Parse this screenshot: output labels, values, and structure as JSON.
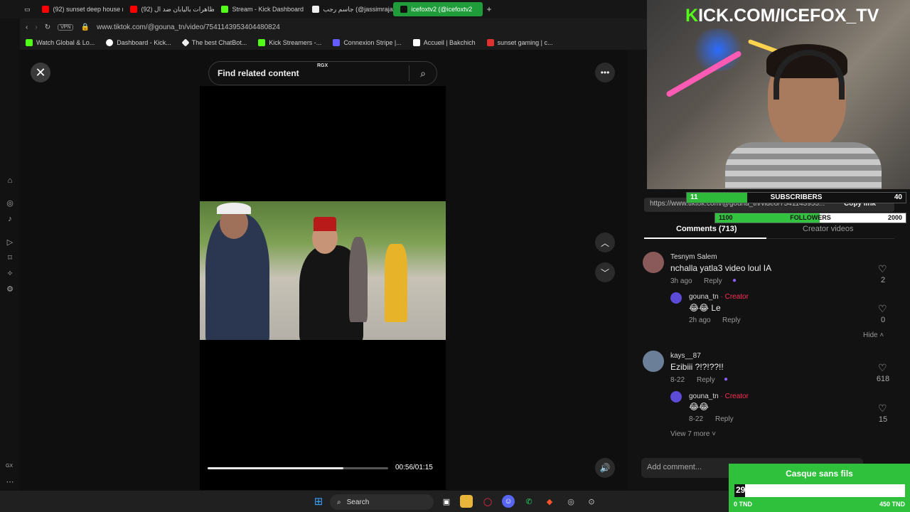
{
  "browser": {
    "tabs": [
      {
        "label": "(92) sunset deep house m",
        "color": "#ff0000",
        "active": false
      },
      {
        "label": "(92) مظاهرات باليابان ضد ال",
        "color": "#ff0000",
        "active": false
      },
      {
        "label": "Stream - Kick Dashboard",
        "color": "#53fc18",
        "active": false
      },
      {
        "label": "جاسم رجب (@jassimrajab)",
        "color": "#ffffff",
        "active": false
      },
      {
        "label": "icefoxtv2 (@icefoxtv2",
        "color": "#ffffff",
        "active": true
      }
    ],
    "vpn_label": "VPN",
    "url": "www.tiktok.com/@gouna_tn/video/7541143953404480824",
    "bookmarks": [
      "Watch Global & Lo...",
      "Dashboard - Kick...",
      "The best ChatBot...",
      "Kick Streamers -...",
      "Connexion Stripe |...",
      "Accueil | Bakchich",
      "sunset gaming | c..."
    ]
  },
  "sidebar": {
    "gx_label": "GX"
  },
  "tiktok": {
    "search_placeholder": "Find related content",
    "rgx_label": "RGX",
    "time": "00:56/01:15",
    "progress_fraction": 0.75,
    "link_text": "https://www.tiktok.com/@gouna_tn/video/7541143953...",
    "copy_link": "Copy link",
    "tab_comments": "Comments (713)",
    "tab_creator": "Creator videos",
    "comments": [
      {
        "name": "Tesnym Salem",
        "text": "nchalla yatla3 video loul IA",
        "time": "3h ago",
        "reply": "Reply",
        "likes": "2"
      },
      {
        "name": "gouna_tn",
        "creator": "· Creator",
        "text": "😂😂 Le",
        "time": "2h ago",
        "reply": "Reply",
        "likes": "0"
      },
      {
        "name": "kays__87",
        "text": "Ezibiii ?!?!??!!",
        "time": "8-22",
        "reply": "Reply",
        "likes": "618"
      },
      {
        "name": "gouna_tn",
        "creator": "· Creator",
        "text": "😂😂",
        "time": "8-22",
        "reply": "Reply",
        "likes": "15"
      }
    ],
    "hide_label": "Hide",
    "view_more": "View 7 more",
    "add_comment": "Add comment..."
  },
  "overlay": {
    "brand_k": "K",
    "brand_rest": "ICK.COM/ICEFOX_TV",
    "subs": {
      "current": "11",
      "label": "SUBSCRIBERS",
      "goal": "40",
      "fraction": 0.275
    },
    "followers": {
      "current": "1100",
      "label": "FOLLOWERS",
      "goal": "2000",
      "fraction": 0.55
    },
    "goal_widget": {
      "title": "Casque sans fils",
      "value": "29",
      "min": "0 TND",
      "max": "450 TND",
      "fraction": 0.064
    }
  },
  "taskbar": {
    "search_label": "Search"
  }
}
